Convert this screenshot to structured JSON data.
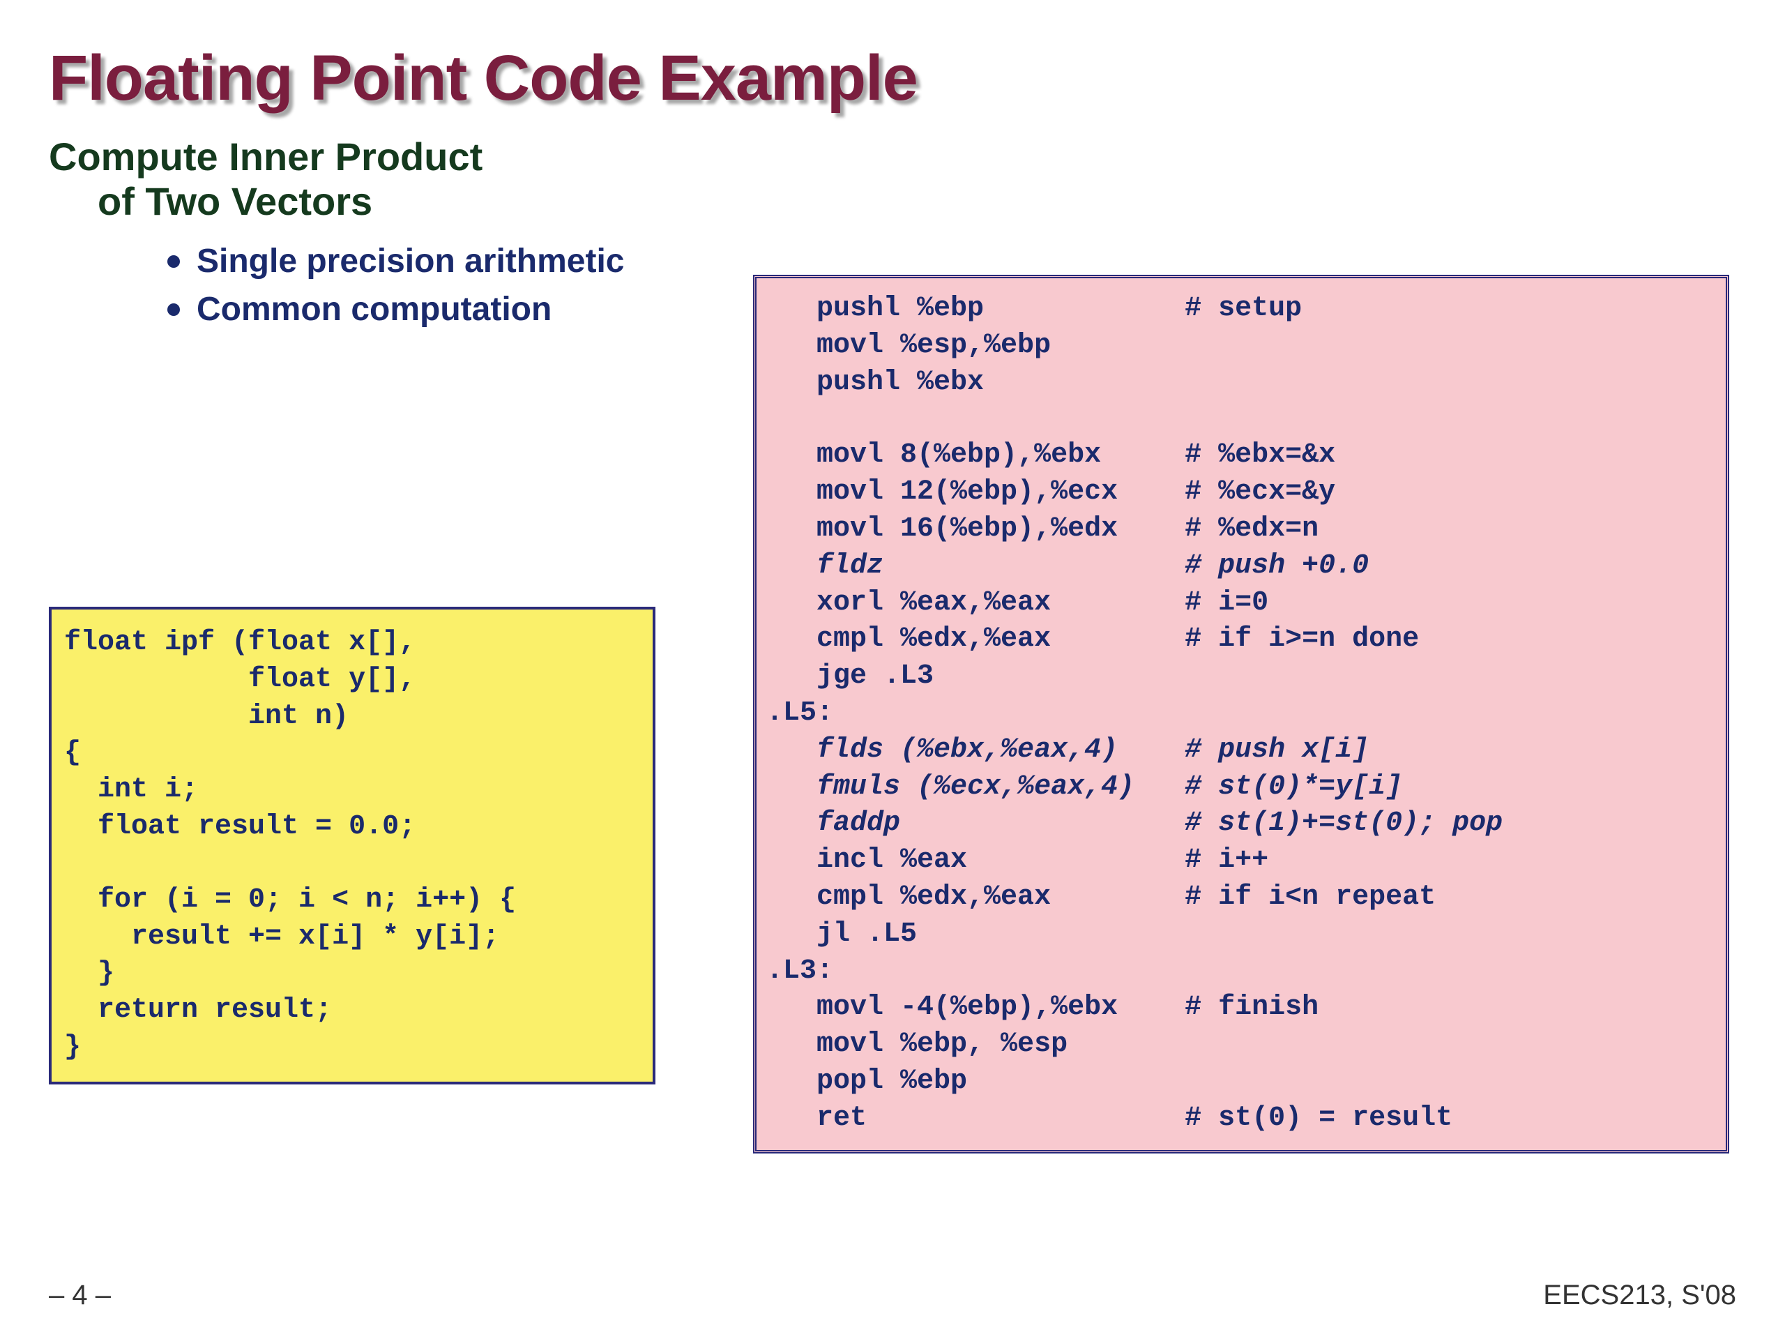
{
  "title": "Floating Point Code Example",
  "subtitle": {
    "line1": "Compute Inner Product",
    "line2": "of Two Vectors"
  },
  "bullets": [
    "Single precision arithmetic",
    "Common computation"
  ],
  "c_code": [
    "float ipf (float x[],",
    "           float y[],",
    "           int n)",
    "{",
    "  int i;",
    "  float result = 0.0;",
    "",
    "  for (i = 0; i < n; i++) {",
    "    result += x[i] * y[i];",
    "  }",
    "  return result;",
    "}"
  ],
  "asm_code": [
    {
      "t": "   pushl %ebp            # setup",
      "i": false
    },
    {
      "t": "   movl %esp,%ebp",
      "i": false
    },
    {
      "t": "   pushl %ebx",
      "i": false
    },
    {
      "t": "",
      "i": false
    },
    {
      "t": "   movl 8(%ebp),%ebx     # %ebx=&x",
      "i": false
    },
    {
      "t": "   movl 12(%ebp),%ecx    # %ecx=&y",
      "i": false
    },
    {
      "t": "   movl 16(%ebp),%edx    # %edx=n",
      "i": false
    },
    {
      "t": "   fldz                  # push +0.0",
      "i": true
    },
    {
      "t": "   xorl %eax,%eax        # i=0",
      "i": false
    },
    {
      "t": "   cmpl %edx,%eax        # if i>=n done",
      "i": false
    },
    {
      "t": "   jge .L3",
      "i": false
    },
    {
      "t": ".L5:",
      "i": false
    },
    {
      "t": "   flds (%ebx,%eax,4)    # push x[i]",
      "i": true
    },
    {
      "t": "   fmuls (%ecx,%eax,4)   # st(0)*=y[i]",
      "i": true
    },
    {
      "t": "   faddp                 # st(1)+=st(0); pop",
      "i": true
    },
    {
      "t": "   incl %eax             # i++",
      "i": false
    },
    {
      "t": "   cmpl %edx,%eax        # if i<n repeat",
      "i": false
    },
    {
      "t": "   jl .L5",
      "i": false
    },
    {
      "t": ".L3:",
      "i": false
    },
    {
      "t": "   movl -4(%ebp),%ebx    # finish",
      "i": false
    },
    {
      "t": "   movl %ebp, %esp",
      "i": false
    },
    {
      "t": "   popl %ebp",
      "i": false
    },
    {
      "t": "   ret                   # st(0) = result",
      "i": false
    }
  ],
  "footer": {
    "left": "– 4 –",
    "right": "EECS213, S'08"
  }
}
